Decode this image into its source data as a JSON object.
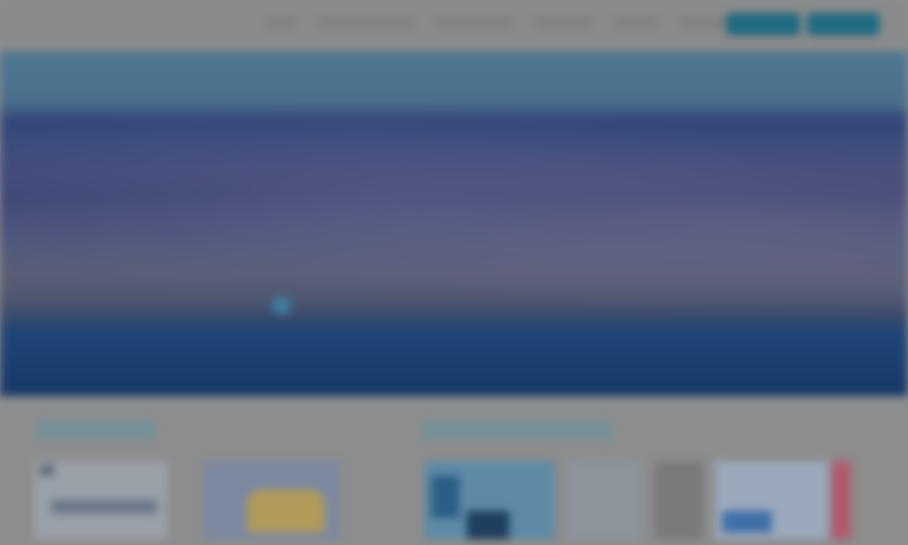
{
  "header": {
    "logo": "",
    "nav": [
      "",
      "",
      "",
      "",
      "",
      ""
    ],
    "buttons": [
      "",
      ""
    ]
  },
  "hero": {
    "title": "",
    "subtitle": ""
  },
  "sections": {
    "left_title": "",
    "right_title": ""
  },
  "colors": {
    "accent": "#1f6b82",
    "section_title": "#4d97b0",
    "overlay": "#8d8d8d"
  }
}
